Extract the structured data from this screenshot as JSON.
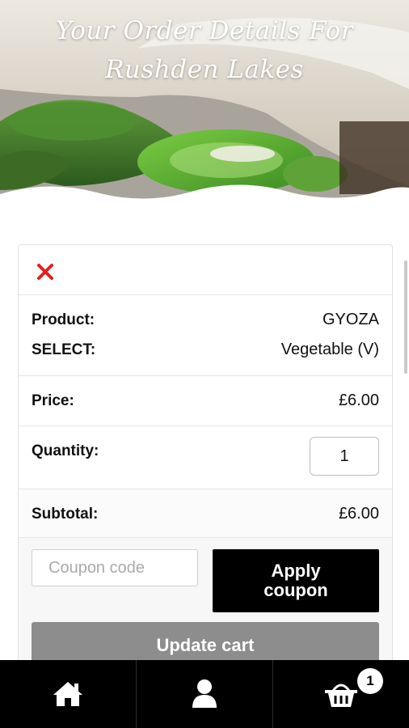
{
  "header": {
    "title": "Your Order Details For Rushden Lakes"
  },
  "cart": {
    "remove_icon": "close-icon",
    "product_label": "Product:",
    "product_value": "GYOZA",
    "select_label": "SELECT:",
    "select_value": "Vegetable (V)",
    "price_label": "Price:",
    "price_value": "£6.00",
    "quantity_label": "Quantity:",
    "quantity_value": "1",
    "subtotal_label": "Subtotal:",
    "subtotal_value": "£6.00"
  },
  "coupon": {
    "placeholder": "Coupon code",
    "apply_label": "Apply coupon"
  },
  "update_label": "Update cart",
  "nav": {
    "items": [
      {
        "icon": "home-icon"
      },
      {
        "icon": "user-icon"
      },
      {
        "icon": "basket-icon"
      }
    ],
    "cart_badge": "1"
  },
  "colors": {
    "remove": "#e02020",
    "primary_button": "#000000",
    "update_button": "#8d8d8d",
    "nav_background": "#000000"
  }
}
